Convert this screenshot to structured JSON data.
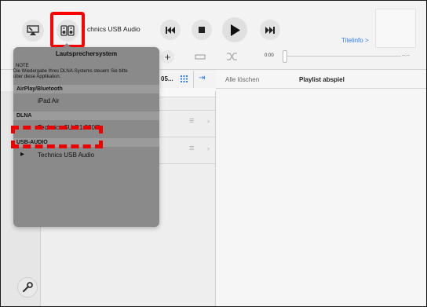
{
  "device": {
    "title": "Technics USB Audio",
    "visible_suffix": "chnics USB Audio"
  },
  "titleinfo": "Titelinfo >",
  "time": {
    "elapsed": "0:00",
    "remaining": "--:--"
  },
  "playlist_panel": {
    "delete_all": "Alle löschen",
    "play_playlist": "Playlist abspiel"
  },
  "list_header": {
    "title_fragment": "05..."
  },
  "popup": {
    "title": "Lautsprechersystem",
    "note_label": "NOTE",
    "note_text_line1": "Die Wiedergabe Ihres DLNA-Systems steuern Sie bitte",
    "note_text_line2": "über diese Applikation.",
    "sections": {
      "airplay": "AirPlay/Bluetooth",
      "dlna": "DLNA",
      "usb": "USB-AUDIO"
    },
    "items": {
      "ipad": "iPad Air",
      "dlna_device": "Technics SU-R1 280f2",
      "usb_device": "Technics USB Audio"
    }
  },
  "icons": {
    "cast": "airplay-speaker-icon",
    "speakers": "speaker-selection-icon",
    "prev": "previous-track-icon",
    "stop": "stop-icon",
    "play": "play-icon",
    "next": "next-track-icon",
    "add": "add-icon",
    "repeat": "repeat-icon",
    "shuffle": "shuffle-icon",
    "grid": "grid-view-icon",
    "settings": "wrench-icon"
  },
  "colors": {
    "accent_blue": "#2f7bf5",
    "highlight_red": "#ff0000",
    "popup_bg": "#8a8a8a"
  }
}
